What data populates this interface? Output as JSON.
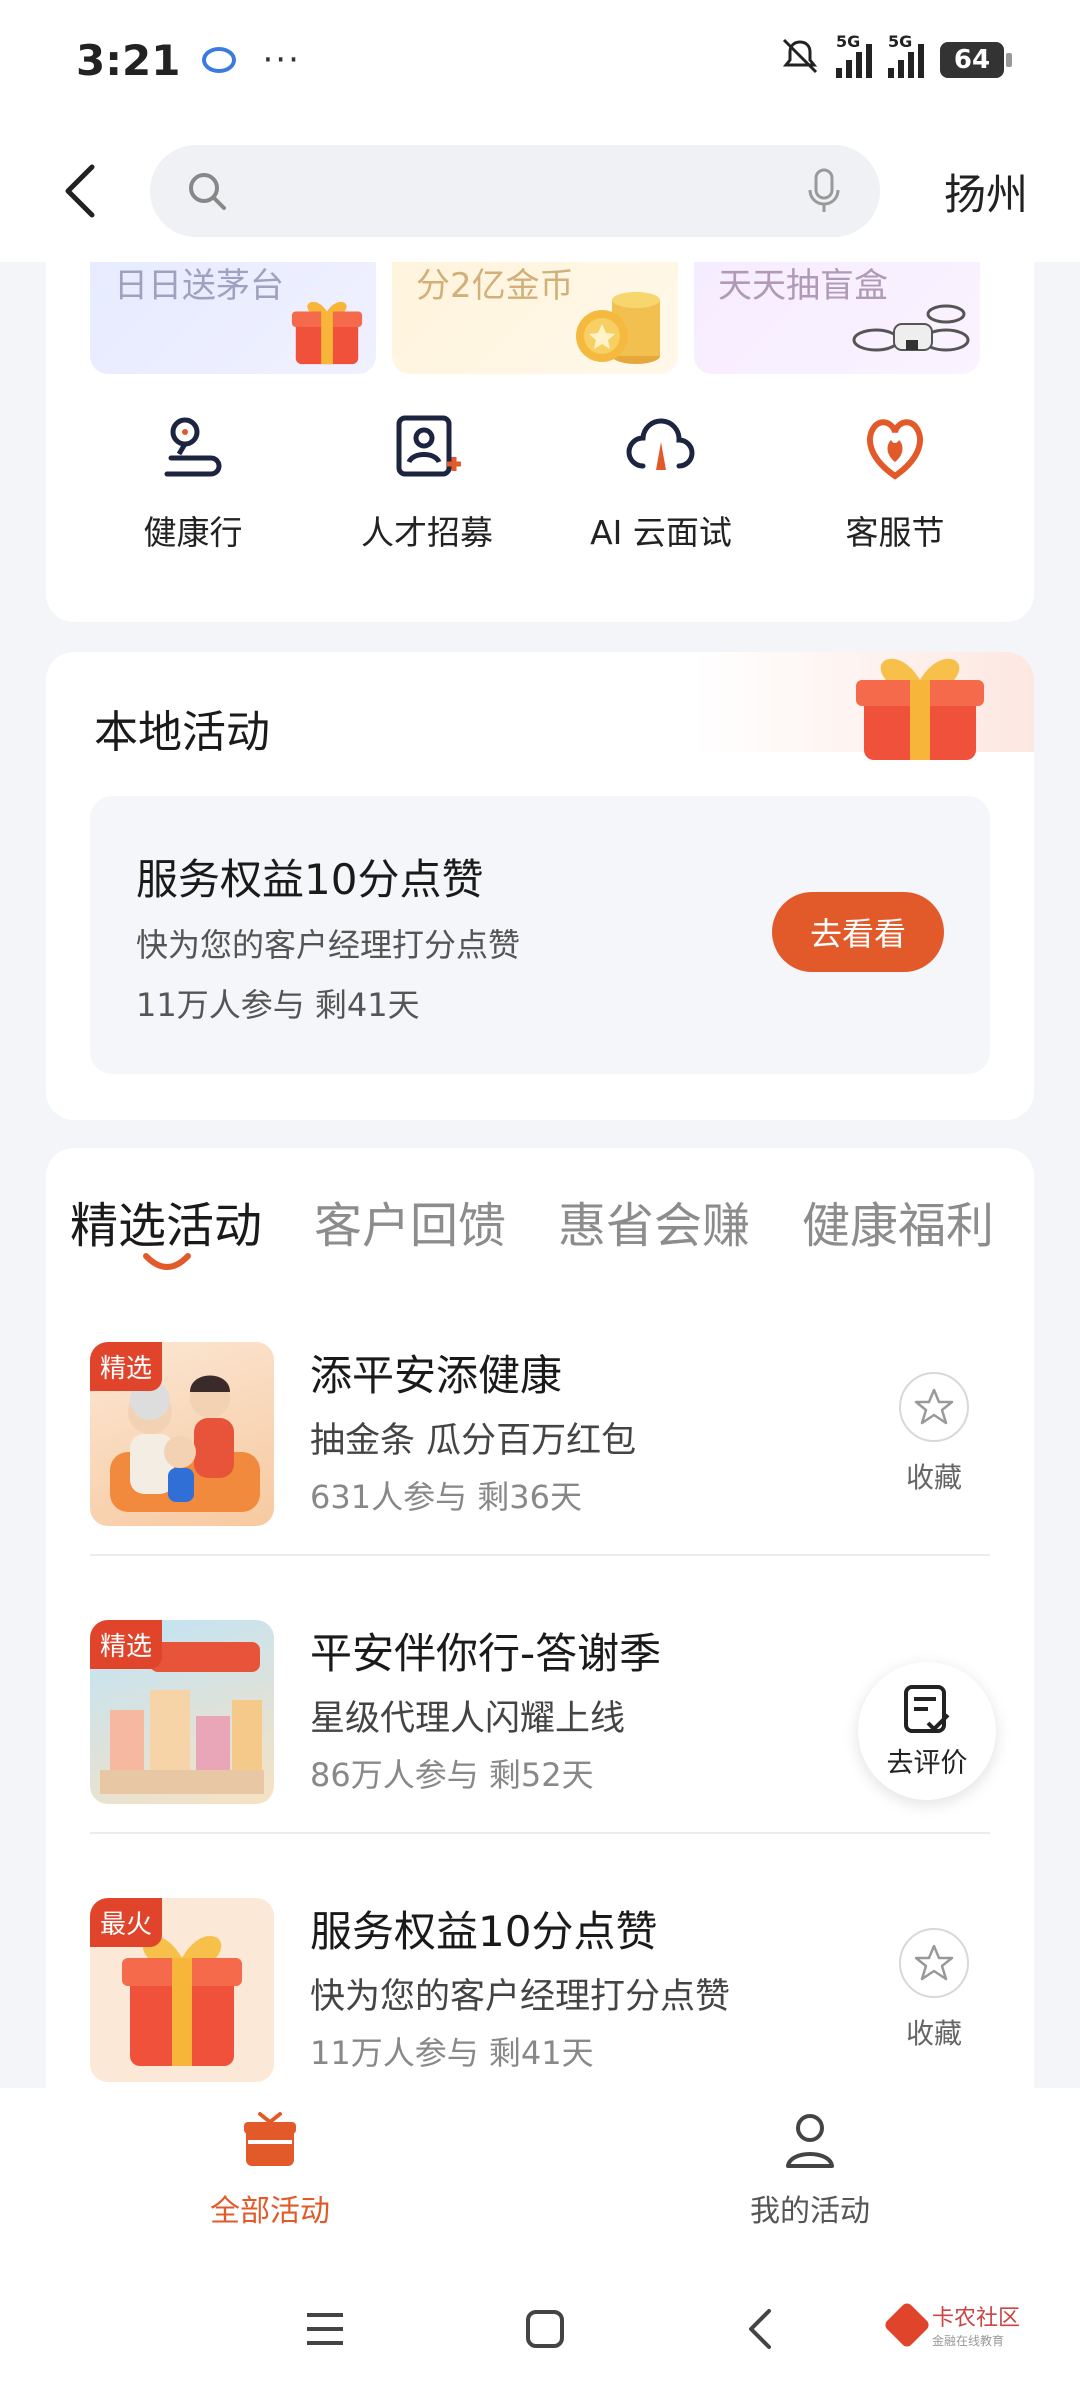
{
  "status_bar": {
    "time": "3:21",
    "dots": "···",
    "signal1": "5G",
    "signal2": "5G",
    "battery": "64"
  },
  "header": {
    "search_placeholder": "",
    "city": "扬州"
  },
  "promos": [
    {
      "label": "日日送茅台"
    },
    {
      "label": "分2亿金币"
    },
    {
      "label": "天天抽盲盒"
    }
  ],
  "shortcuts": [
    {
      "label": "健康行",
      "icon": "location-path-icon"
    },
    {
      "label": "人才招募",
      "icon": "user-add-icon"
    },
    {
      "label": "AI 云面试",
      "icon": "cloud-icon"
    },
    {
      "label": "客服节",
      "icon": "heart-flame-icon"
    }
  ],
  "local": {
    "title": "本地活动",
    "card": {
      "title": "服务权益10分点赞",
      "subtitle": "快为您的客户经理打分点赞",
      "meta": "11万人参与   剩41天",
      "button": "去看看"
    }
  },
  "tabs": [
    {
      "label": "精选活动",
      "active": true
    },
    {
      "label": "客户回馈",
      "active": false
    },
    {
      "label": "惠省会赚",
      "active": false
    },
    {
      "label": "健康福利",
      "active": false
    }
  ],
  "items": [
    {
      "badge": "精选",
      "title": "添平安添健康",
      "subtitle": "抽金条 瓜分百万红包",
      "meta": "631人参与    剩36天",
      "fav": "收藏"
    },
    {
      "badge": "精选",
      "title": "平安伴你行-答谢季",
      "subtitle": "星级代理人闪耀上线",
      "meta": "86万人参与    剩52天",
      "fav": "收藏"
    },
    {
      "badge": "最火",
      "title": "服务权益10分点赞",
      "subtitle": "快为您的客户经理打分点赞",
      "meta": "11万人参与    剩41天",
      "fav": "收藏"
    }
  ],
  "float_button": "去评价",
  "bottom_nav": [
    {
      "label": "全部活动",
      "active": true
    },
    {
      "label": "我的活动",
      "active": false
    }
  ],
  "watermark": {
    "title": "卡农社区",
    "sub": "金融在线教育"
  },
  "colors": {
    "accent": "#e35a2a",
    "badge": "#e0452c"
  }
}
